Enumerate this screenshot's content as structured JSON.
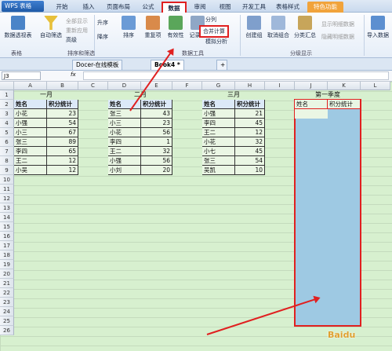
{
  "app": {
    "logo": "WPS 表格"
  },
  "tabs": [
    "开始",
    "插入",
    "页面布局",
    "公式",
    "数据",
    "审阅",
    "视图",
    "开发工具",
    "表格样式",
    "特色功能"
  ],
  "ribbon": {
    "pivot": "数据透视表",
    "autofilter": "自动筛选",
    "show_all": "全部显示",
    "reapply": "重新应用",
    "advanced": "高级",
    "sort_asc": "升序",
    "sort_desc": "降序",
    "sort": "排序",
    "dup": "重复项",
    "valid": "有效性",
    "record": "记录单",
    "split": "分列",
    "consolidate": "合并计算",
    "whatif": "模拟分析",
    "group": "创建组",
    "ungroup": "取消组合",
    "subtotal": "分类汇总",
    "show_detail": "显示明细数据",
    "hide_detail": "隐藏明细数据",
    "import": "导入数据",
    "grp_table": "表格",
    "grp_sort": "排序和筛选",
    "grp_datatools": "数据工具",
    "grp_outline": "分级显示"
  },
  "doc_tabs": [
    "Docer-在线模板",
    "Book4 *"
  ],
  "formula": {
    "namebox": "J3",
    "fx": "fx"
  },
  "columns": [
    "A",
    "B",
    "C",
    "D",
    "E",
    "F",
    "G",
    "H",
    "I",
    "J",
    "K",
    "L"
  ],
  "rows": [
    "1",
    "2",
    "3",
    "4",
    "5",
    "6",
    "7",
    "8",
    "9",
    "10",
    "11",
    "12",
    "13",
    "14",
    "15",
    "16",
    "17",
    "18",
    "19",
    "20",
    "21",
    "22",
    "23",
    "24",
    "25",
    "26"
  ],
  "tables": [
    {
      "title": "一月",
      "headers": [
        "姓名",
        "积分统计"
      ],
      "rows": [
        [
          "小花",
          "23"
        ],
        [
          "小强",
          "54"
        ],
        [
          "小三",
          "67"
        ],
        [
          "张三",
          "89"
        ],
        [
          "李四",
          "65"
        ],
        [
          "王二",
          "12"
        ],
        [
          "小吴",
          "12"
        ]
      ]
    },
    {
      "title": "二月",
      "headers": [
        "姓名",
        "积分统计"
      ],
      "rows": [
        [
          "张三",
          "43"
        ],
        [
          "小三",
          "23"
        ],
        [
          "小花",
          "56"
        ],
        [
          "李四",
          "1"
        ],
        [
          "王二",
          "32"
        ],
        [
          "小强",
          "56"
        ],
        [
          "小刘",
          "20"
        ]
      ]
    },
    {
      "title": "三月",
      "headers": [
        "姓名",
        "积分统计"
      ],
      "rows": [
        [
          "小强",
          "21"
        ],
        [
          "李四",
          "45"
        ],
        [
          "王二",
          "12"
        ],
        [
          "小花",
          "32"
        ],
        [
          "小七",
          "45"
        ],
        [
          "张三",
          "54"
        ],
        [
          "吴凯",
          "10"
        ]
      ]
    }
  ],
  "quarter": {
    "title": "第一季度",
    "headers": [
      "姓名",
      "积分统计"
    ]
  },
  "watermark": "Baidu"
}
